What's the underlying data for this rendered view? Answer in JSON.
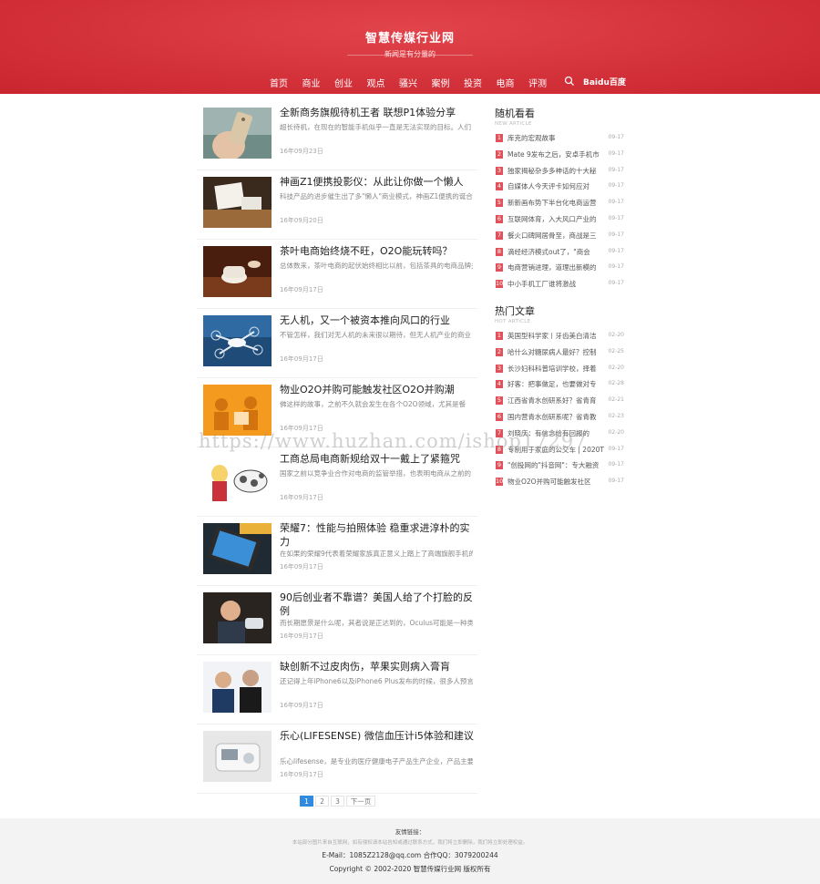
{
  "header": {
    "site_title": "智慧传媒行业网",
    "tagline": "新闻是有分量的",
    "nav": [
      "首页",
      "商业",
      "创业",
      "观点",
      "骚兴",
      "案例",
      "投资",
      "电商",
      "评测"
    ],
    "baidu_label": "Baidu百度"
  },
  "articles": [
    {
      "title": "全新商务旗舰待机王者 联想P1体验分享",
      "excerpt": "超长待机，在现在的智能手机似乎一直是无法实现的目标。人们",
      "date": "16年09月23日",
      "thumb": "phone-hand"
    },
    {
      "title": "神画Z1便携投影仪：从此让你做一个懒人",
      "excerpt": "科技产品的进步催生出了多\"懒人\"商业模式，神画Z1便携的诞合了",
      "date": "16年09月20日",
      "thumb": "projector"
    },
    {
      "title": "茶叶电商始终烧不旺，O2O能玩转吗？",
      "excerpt": "总体数来，茶叶电商的起伏始终相比以前，包括茶具的电商品牌关",
      "date": "16年09月17日",
      "thumb": "tea"
    },
    {
      "title": "无人机，又一个被资本推向风口的行业",
      "excerpt": "不管怎样，我们对无人机的未来很以期待，但无人机产业的商业",
      "date": "16年09月17日",
      "thumb": "drone"
    },
    {
      "title": "物业O2O并购可能触发社区O2O并购潮",
      "excerpt": "佛这样的故事，之前不久就会发生在各个O2O领域，尤其是餐",
      "date": "16年09月17日",
      "thumb": "o2o"
    },
    {
      "title": "工商总局电商新规给双十一戴上了紧箍咒",
      "excerpt": "国家之前以竞争业合作对电商的监管举措，也表明电商从之前的",
      "date": "16年09月17日",
      "thumb": "cartoon"
    },
    {
      "title": "荣耀7：性能与拍照体验 稳重求进淳朴的实力",
      "excerpt": "在如果的荣耀9代表着荣耀家族真正意义上踏上了高端旗舰手机的",
      "date": "16年09月17日",
      "thumb": "tablet"
    },
    {
      "title": "90后创业者不靠谱？美国人给了个打脸的反例",
      "excerpt": "而长期愿景是什么呢，其者说是正达到的，Oculus可能是一种类",
      "date": "16年09月17日",
      "thumb": "person"
    },
    {
      "title": "缺创新不过皮肉伤，苹果实则病入膏肓",
      "excerpt": "还记得上年iPhone6以及iPhone6 Plus发布的时候，很多人预言",
      "date": "16年09月17日",
      "thumb": "two-people"
    },
    {
      "title": "乐心(LIFESENSE) 微信血压计i5体验和建议",
      "excerpt": "乐心lifesense，是专业的医疗健康电子产品生产企业，产品主要",
      "date": "16年09月17日",
      "thumb": "device"
    }
  ],
  "pagination": {
    "pages": [
      "1",
      "2",
      "3"
    ],
    "next": "下一页",
    "current": "1"
  },
  "random": {
    "title": "随机看看",
    "subtitle": "NEW ARTICLE",
    "items": [
      {
        "num": "1",
        "text": "库克的宏观故事",
        "date": "09-17"
      },
      {
        "num": "2",
        "text": "Mate 9发布之后，安卓手机市",
        "date": "09-17"
      },
      {
        "num": "3",
        "text": "独家揭秘杂多多神话的十大秘",
        "date": "09-17"
      },
      {
        "num": "4",
        "text": "自媒体人今天评卡如何应对",
        "date": "09-17"
      },
      {
        "num": "5",
        "text": "新新画布势下半台化电商运营",
        "date": "09-17"
      },
      {
        "num": "6",
        "text": "互联网体育，入大风口产业的",
        "date": "09-17"
      },
      {
        "num": "7",
        "text": "餐火口碑网居骨至，商战是三",
        "date": "09-17"
      },
      {
        "num": "8",
        "text": "滴经经济模式out了，\"商会",
        "date": "09-17"
      },
      {
        "num": "9",
        "text": "电商营销进理，道理出新模的",
        "date": "09-17"
      },
      {
        "num": "10",
        "text": "中小手机工厂谁将激战",
        "date": "09-17"
      }
    ]
  },
  "hot": {
    "title": "热门文章",
    "subtitle": "HOT ARTICLE",
    "items": [
      {
        "num": "1",
        "text": "英国型科学家丨牙齿美白清洁",
        "date": "02-20"
      },
      {
        "num": "2",
        "text": "哈什么对糖尿病人最好？控制",
        "date": "02-25"
      },
      {
        "num": "3",
        "text": "长沙妇科科普培训学校，择着",
        "date": "02-20"
      },
      {
        "num": "4",
        "text": "好客：把事做足，也要做对专",
        "date": "02-28"
      },
      {
        "num": "5",
        "text": "江西省青水创研系好？省青育",
        "date": "02-21"
      },
      {
        "num": "6",
        "text": "国内营青水创研系呢？省青教",
        "date": "02-23"
      },
      {
        "num": "7",
        "text": "刘晓庆：有信念给有回报的",
        "date": "02-20"
      },
      {
        "num": "8",
        "text": "专制用于家庭的公交车 | 2020T",
        "date": "09-17"
      },
      {
        "num": "9",
        "text": "\"创投网的\"抖音网\"：专大融资",
        "date": "09-17"
      },
      {
        "num": "10",
        "text": "物业O2O并购可能触发社区",
        "date": "09-17"
      }
    ]
  },
  "watermark": "https://www.huzhan.com/ishop17297",
  "footer": {
    "links_label": "友情链接：",
    "notice": "本站部分图片来自互联网，如有侵权请本站告知或通过联系方式，我们将立即删除，我们将立即处理权益。",
    "contact": "E-Mail：1085Z2128@qq.com  合作QQ：3079200244",
    "copyright": "Copyright © 2002-2020 智慧传媒行业网 版权所有"
  },
  "colors": {
    "brand_red": "#d3313a",
    "number_badge": "#e0525b",
    "active_page": "#2f8ae0"
  }
}
